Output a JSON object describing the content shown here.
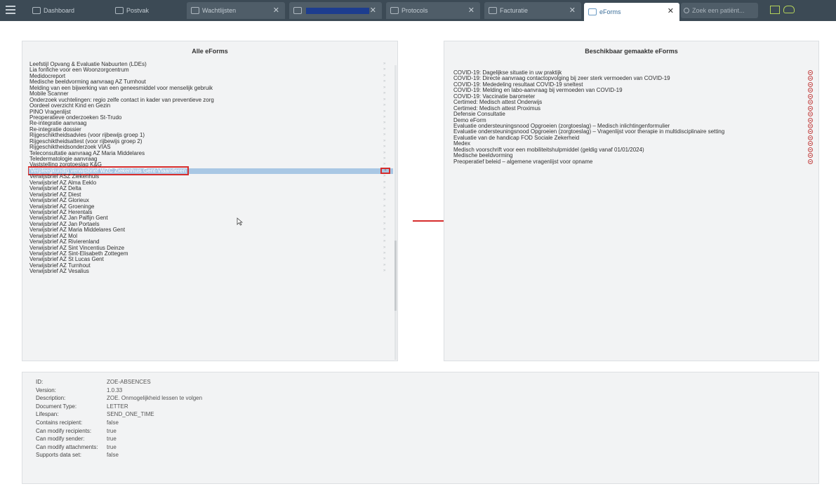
{
  "tabs": [
    {
      "label": "Dashboard"
    },
    {
      "label": "Postvak"
    },
    {
      "label": "Wachtlijsten"
    },
    {
      "label": ""
    },
    {
      "label": "Protocols"
    },
    {
      "label": "Facturatie"
    },
    {
      "label": "eForms"
    }
  ],
  "search": {
    "placeholder": "Zoek een patiënt..."
  },
  "left_panel": {
    "title": "Alle eForms",
    "items": [
      "Leefstijl Opvang & Evaluatie Nabuurten (LDEs)",
      "Lia fonfiche voor een Woonzorgcentrum",
      "Medidocreport",
      "Medische beeldvorming aanvraag AZ Turnhout",
      "Melding van een bijwerking van een geneesmiddel voor menselijk gebruik",
      "Mobile Scanner",
      "Onderzoek vuchtelingen: regio zelfe contact in kader van preventieve zorg",
      "Oordeel overzicht Kind en Gezin",
      "PINO Vragenlijst",
      "Preoperatieve onderzoeken St-Trudo",
      "Re-integratie aanvraag",
      "Re-integratie dossier",
      "Rijgeschiktheidsadvies (voor rijbewijs groep 1)",
      "Rijgeschiktheidsattest (voor rijbewijs groep 2)",
      "Rijgeschiktheidsonderzoek VIAS",
      "Teleconsultatie aanvraag AZ Maria Middelares",
      "Teledermatologie aanvraag",
      "Vaststelling zorgtoeslag K&G",
      "Verpleegkundig verwijsbrief WZC Ziekenhuis Gent-Vlaanderen",
      "Verwijsbrief ASZ Ziekenhuis",
      "Verwijsbrief AZ Alma Eeklo",
      "Verwijsbrief AZ Delta",
      "Verwijsbrief AZ Diest",
      "Verwijsbrief AZ Glorieux",
      "Verwijsbrief AZ Groeninge",
      "Verwijsbrief AZ Herentals",
      "Verwijsbrief AZ Jan Palfijn Gent",
      "Verwijsbrief AZ Jan Portaels",
      "Verwijsbrief AZ Maria Middelares Gent",
      "Verwijsbrief AZ Mol",
      "Verwijsbrief AZ Rivierenland",
      "Verwijsbrief AZ Sint Vincentius Deinze",
      "Verwijsbrief AZ Sint-Elisabeth Zottegem",
      "Verwijsbrief AZ St Lucas Gent",
      "Verwijsbrief AZ Turnhout",
      "Verwijsbrief AZ Vesalius"
    ],
    "selected_index": 18
  },
  "right_panel": {
    "title": "Beschikbaar gemaakte eForms",
    "items": [
      "COVID-19: Dagelijkse situatie in uw praktijk",
      "COVID-19: Directe aanvraag contactopvolging bij zeer sterk vermoeden van COVID-19",
      "COVID-19: Mededeling resultaat COVID-19 sneltest",
      "COVID-19: Melding en labo-aanvraag bij vermoeden van COVID-19",
      "COVID-19: Vaccinatie barometer",
      "Certimed: Medisch attest Onderwijs",
      "Certimed: Medisch attest Proximus",
      "Defensie Consultatie",
      "Demo eForm",
      "Evaluatie ondersteuningsnood Opgroeien (zorgtoeslag) – Medisch inlichtingenformulier",
      "Evaluatie ondersteuningsnood Opgroeien (zorgtoeslag) – Vragenlijst voor therapie in multidisciplinaire setting",
      "Evaluatie van de handicap FOD Sociale Zekerheid",
      "Medex",
      "Medisch voorschrift voor een mobiliteitshulpmiddel (geldig vanaf 01/01/2024)",
      "Medische beeldvorming",
      "Preoperatief beleid – algemene vragenlijst voor opname"
    ]
  },
  "info": {
    "rows": [
      {
        "label": "ID:",
        "value": "ZOE-ABSENCES"
      },
      {
        "label": "Version:",
        "value": "1.0.33"
      },
      {
        "label": "Description:",
        "value": "ZOE. Onmogelijkheid lessen te volgen"
      },
      {
        "label": "Document Type:",
        "value": "LETTER"
      },
      {
        "label": "Lifespan:",
        "value": "SEND_ONE_TIME"
      },
      {
        "label": "Contains recipient:",
        "value": "false"
      },
      {
        "label": "Can modify recipients:",
        "value": "true"
      },
      {
        "label": "Can modify sender:",
        "value": "true"
      },
      {
        "label": "Can modify attachments:",
        "value": "true"
      },
      {
        "label": "Supports data set:",
        "value": "false"
      }
    ]
  },
  "colors": {
    "topbar": "#3c4a55",
    "selection": "#a9c7e4",
    "highlight_red": "#d62c2c",
    "remove_icon": "#c44545"
  },
  "icons": {
    "menu": "hamburger-icon",
    "add": "add-arrow-icon",
    "remove": "remove-circle-icon",
    "annotation": "red-arrow-right"
  }
}
